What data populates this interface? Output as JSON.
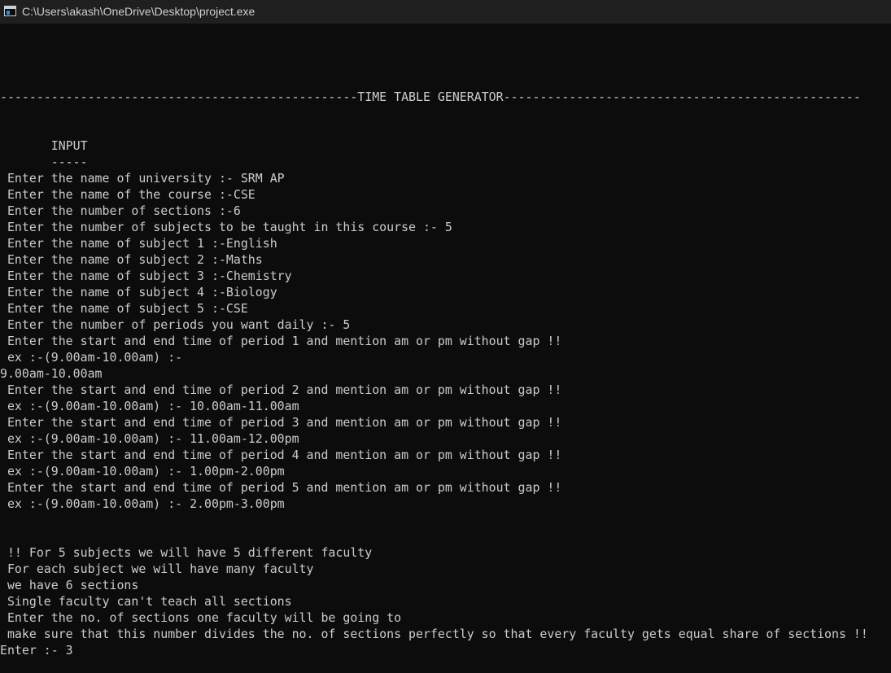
{
  "window": {
    "title": "C:\\Users\\akash\\OneDrive\\Desktop\\project.exe",
    "icon": "console-app-icon"
  },
  "console": {
    "lines": [
      "",
      "",
      "",
      "-------------------------------------------------TIME TABLE GENERATOR-------------------------------------------------",
      "",
      "",
      "       INPUT",
      "       -----",
      " Enter the name of university :- SRM AP",
      " Enter the name of the course :-CSE",
      " Enter the number of sections :-6",
      " Enter the number of subjects to be taught in this course :- 5",
      " Enter the name of subject 1 :-English",
      " Enter the name of subject 2 :-Maths",
      " Enter the name of subject 3 :-Chemistry",
      " Enter the name of subject 4 :-Biology",
      " Enter the name of subject 5 :-CSE",
      " Enter the number of periods you want daily :- 5",
      " Enter the start and end time of period 1 and mention am or pm without gap !!",
      " ex :-(9.00am-10.00am) :-",
      "9.00am-10.00am",
      " Enter the start and end time of period 2 and mention am or pm without gap !!",
      " ex :-(9.00am-10.00am) :- 10.00am-11.00am",
      " Enter the start and end time of period 3 and mention am or pm without gap !!",
      " ex :-(9.00am-10.00am) :- 11.00am-12.00pm",
      " Enter the start and end time of period 4 and mention am or pm without gap !!",
      " ex :-(9.00am-10.00am) :- 1.00pm-2.00pm",
      " Enter the start and end time of period 5 and mention am or pm without gap !!",
      " ex :-(9.00am-10.00am) :- 2.00pm-3.00pm",
      "",
      "",
      " !! For 5 subjects we will have 5 different faculty",
      " For each subject we will have many faculty",
      " we have 6 sections",
      " Single faculty can't teach all sections",
      " Enter the no. of sections one faculty will be going to",
      " make sure that this number divides the no. of sections perfectly so that every faculty gets equal share of sections !!",
      "Enter :- 3"
    ]
  },
  "colors": {
    "background": "#0c0c0c",
    "titlebar": "#1f1f1f",
    "text": "#cccccc"
  }
}
